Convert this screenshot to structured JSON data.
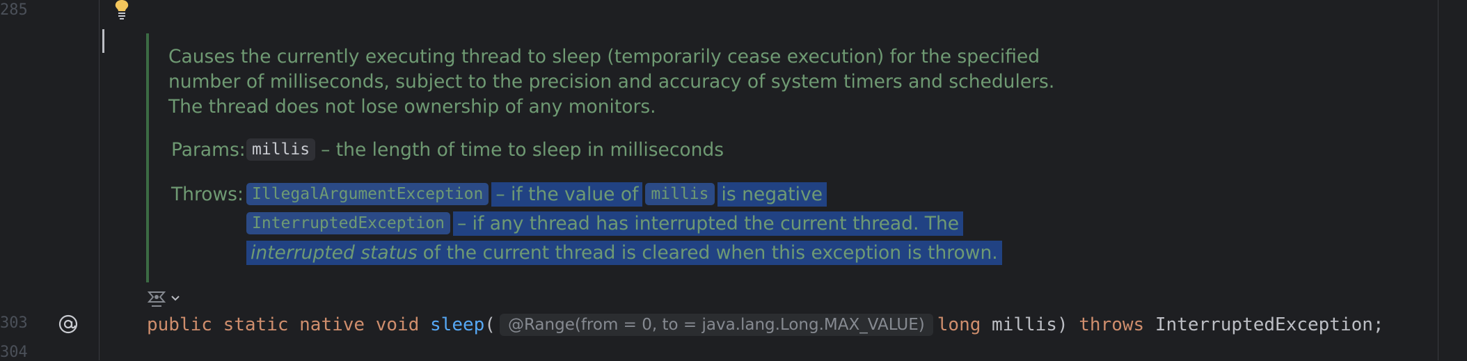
{
  "editor": {
    "line_numbers": {
      "top": "285",
      "code": "303",
      "bottom": "304"
    },
    "doc": {
      "description_lines": [
        "Causes the currently executing thread to sleep (temporarily cease execution) for the specified",
        "number of milliseconds, subject to the precision and accuracy of system timers and schedulers.",
        "The thread does not lose ownership of any monitors."
      ],
      "params_label": "Params:",
      "param_name": "millis",
      "param_desc": "– the length of time to sleep in milliseconds",
      "throws_label": "Throws:",
      "throws": [
        {
          "exception": "IllegalArgumentException",
          "desc_a": "– if the value of",
          "code": "millis",
          "desc_b": "is negative"
        },
        {
          "exception": "InterruptedException",
          "desc_a": "– if any thread has interrupted the current thread. The",
          "italic": "interrupted status",
          "desc_b": "of the current thread is cleared when this exception is thrown."
        }
      ]
    },
    "code": {
      "kw_public": "public",
      "kw_static": "static",
      "kw_native": "native",
      "kw_void": "void",
      "method": "sleep",
      "paren_open": "(",
      "annotation": "@Range(from = 0, to = java.lang.Long.MAX_VALUE)",
      "kw_long": "long",
      "param": " millis)",
      "kw_throws": "throws",
      "exception": " InterruptedException;"
    }
  },
  "colors": {
    "background": "#1e1f22",
    "doc_text": "#6f9a73",
    "selection": "#214283",
    "keyword": "#cf8e6d",
    "method": "#56a8f5"
  },
  "icons": [
    "lightbulb-icon",
    "override-at-icon",
    "render-doc-icon",
    "chevron-down-icon"
  ]
}
